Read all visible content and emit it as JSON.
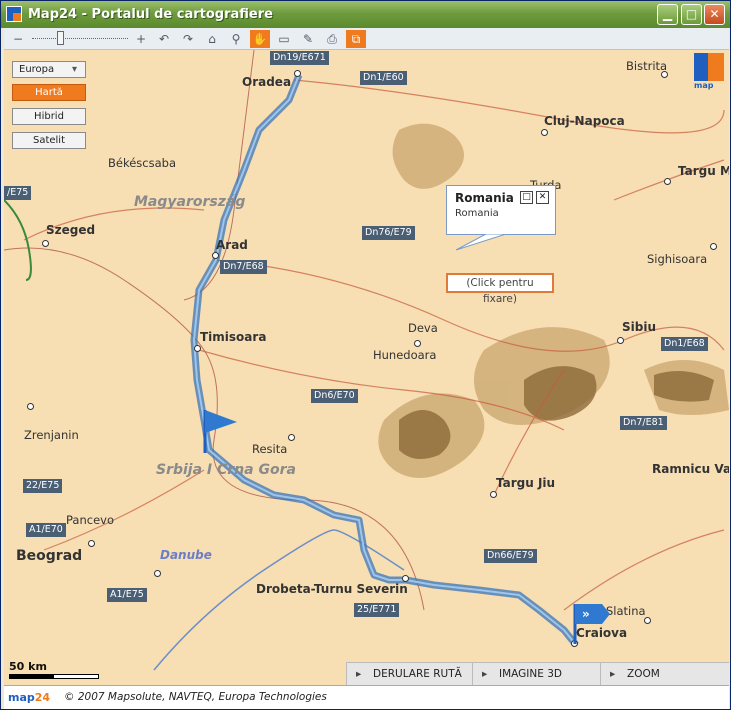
{
  "window": {
    "title": "Map24 - Portalul de cartografiere",
    "minimize_label": "▁",
    "maximize_label": "□",
    "close_label": "✕"
  },
  "toolbar": {
    "zoom_out": "−",
    "zoom_in": "+",
    "undo": "↶",
    "redo": "↷",
    "home": "⌂",
    "pin": "⚲",
    "pan": "✋",
    "measure": "▭",
    "edit": "✎",
    "print": "⎙",
    "window": "⧉"
  },
  "map_type": {
    "region_select": "Europa",
    "map": "Hartă",
    "hybrid": "Hibrid",
    "satellite": "Satelit"
  },
  "cities": [
    {
      "id": "oradea",
      "label": "Oradea"
    },
    {
      "id": "bistrita",
      "label": "Bistrita"
    },
    {
      "id": "cluj",
      "label": "Cluj-Napoca"
    },
    {
      "id": "targum",
      "label": "Targu M"
    },
    {
      "id": "bekescsaba",
      "label": "Békéscsaba"
    },
    {
      "id": "szeged",
      "label": "Szeged"
    },
    {
      "id": "turda",
      "label": "Turda"
    },
    {
      "id": "arad",
      "label": "Arad"
    },
    {
      "id": "sighisoara",
      "label": "Sighisoara"
    },
    {
      "id": "timisoara",
      "label": "Timisoara"
    },
    {
      "id": "deva",
      "label": "Deva"
    },
    {
      "id": "hunedoara",
      "label": "Hunedoara"
    },
    {
      "id": "sibiu",
      "label": "Sibiu"
    },
    {
      "id": "zrenjanin",
      "label": "Zrenjanin"
    },
    {
      "id": "resita",
      "label": "Resita"
    },
    {
      "id": "ramnicu",
      "label": "Ramnicu Va"
    },
    {
      "id": "targujiu",
      "label": "Targu Jiu"
    },
    {
      "id": "pancevo",
      "label": "Pancevo"
    },
    {
      "id": "beograd",
      "label": "Beograd"
    },
    {
      "id": "drobeta",
      "label": "Drobeta-Turnu Severin"
    },
    {
      "id": "slatina",
      "label": "Slatina"
    },
    {
      "id": "craiova",
      "label": "Craiova"
    }
  ],
  "countries": {
    "hungary": "Magyarország",
    "serbia": "Srbija I Crna Gora"
  },
  "river": "Danube",
  "roads": [
    "Dn19/E671",
    "Dn1/E60",
    "/E75",
    "Dn76/E79",
    "Dn7/E68",
    "Dn1/E68",
    "Dn6/E70",
    "Dn7/E81",
    "22/E75",
    "A1/E70",
    "Dn66/E79",
    "A1/E75",
    "25/E771"
  ],
  "popup": {
    "title": "Romania",
    "body": "Romania",
    "click_fix": "(Click pentru fixare)"
  },
  "logo_text": "map",
  "scale_label": "50 km",
  "bottom_bar": {
    "route": "DERULARE RUTĂ",
    "image3d": "IMAGINE 3D",
    "zoom": "ZOOM"
  },
  "footer": {
    "logo": "map",
    "logo_num": "24",
    "copyright": "© 2007 Mapsolute, NAVTEQ, Europa Technologies"
  }
}
